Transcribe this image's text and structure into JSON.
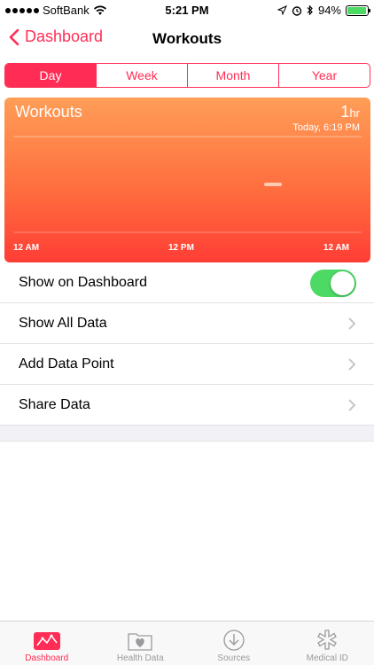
{
  "status_bar": {
    "carrier": "SoftBank",
    "time": "5:21 PM",
    "battery": "94%",
    "battery_level": 0.94
  },
  "nav": {
    "back_label": "Dashboard",
    "title": "Workouts"
  },
  "segments": [
    {
      "label": "Day",
      "active": true
    },
    {
      "label": "Week",
      "active": false
    },
    {
      "label": "Month",
      "active": false
    },
    {
      "label": "Year",
      "active": false
    }
  ],
  "chart": {
    "title": "Workouts",
    "value": "1",
    "unit": "hr",
    "date": "Today, 6:19 PM",
    "x_ticks": [
      "12 AM",
      "12 PM",
      "12 AM"
    ]
  },
  "chart_data": {
    "type": "bar",
    "title": "Workouts",
    "x_ticks": [
      "12 AM",
      "12 PM",
      "12 AM"
    ],
    "series": [
      {
        "x": 18,
        "value": 1
      }
    ],
    "xlim": [
      0,
      24
    ]
  },
  "list": {
    "show_on_dashboard": "Show on Dashboard",
    "show_on_dashboard_on": true,
    "show_all_data": "Show All Data",
    "add_data_point": "Add Data Point",
    "share_data": "Share Data"
  },
  "tabs": [
    {
      "label": "Dashboard",
      "icon": "dashboard-icon",
      "active": true
    },
    {
      "label": "Health Data",
      "icon": "health-data-icon",
      "active": false
    },
    {
      "label": "Sources",
      "icon": "sources-icon",
      "active": false
    },
    {
      "label": "Medical ID",
      "icon": "medical-id-icon",
      "active": false
    }
  ],
  "colors": {
    "accent": "#ff2d55",
    "toggle_on": "#4cd964"
  }
}
